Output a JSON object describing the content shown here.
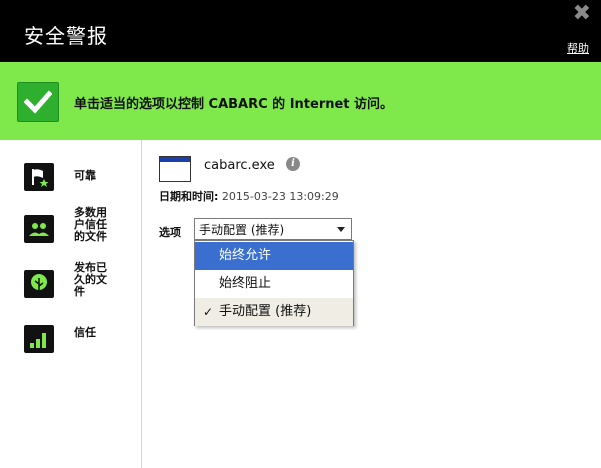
{
  "window": {
    "title": "安全警报",
    "help_label": "帮助",
    "close_glyph": "✖"
  },
  "banner": {
    "message": "单击适当的选项以控制 CABARC 的 Internet 访问。",
    "color": "#7fe84a"
  },
  "sidebar": {
    "items": [
      {
        "label": "可靠",
        "icon": "flag-star-icon"
      },
      {
        "label": "多数用户信任的文件",
        "icon": "users-icon"
      },
      {
        "label": "发布已久的文件",
        "icon": "tree-icon"
      },
      {
        "label": "信任",
        "icon": "signal-bars-icon"
      }
    ]
  },
  "file": {
    "name": "cabarc.exe",
    "datetime_label": "日期和时间:",
    "datetime_value": "2015-03-23 13:09:29"
  },
  "options": {
    "label": "选项",
    "selected": "手动配置 (推荐)",
    "items": [
      {
        "label": "始终允许",
        "state": "highlighted"
      },
      {
        "label": "始终阻止",
        "state": "normal"
      },
      {
        "label": "手动配置 (推荐)",
        "state": "checked",
        "check": "✓"
      }
    ]
  },
  "colors": {
    "accent_green": "#2eb02e",
    "highlight_blue": "#3a6fcf"
  }
}
